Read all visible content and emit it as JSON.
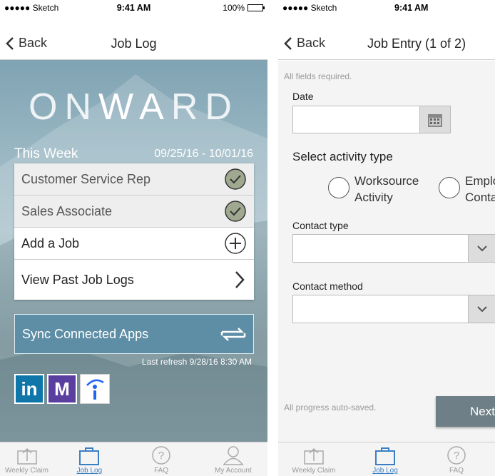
{
  "left": {
    "status": {
      "carrier": "●●●●● Sketch",
      "time": "9:41 AM",
      "battery": "100%"
    },
    "nav": {
      "back": "Back",
      "title": "Job Log"
    },
    "logo": {
      "part1": "ON",
      "part2": "WA",
      "part3": "RD"
    },
    "week": {
      "label": "This Week",
      "range": "09/25/16 - 10/01/16"
    },
    "jobs": [
      {
        "label": "Customer Service Rep",
        "icon": "check-circle-icon"
      },
      {
        "label": "Sales Associate",
        "icon": "check-circle-icon"
      },
      {
        "label": "Add a Job",
        "icon": "plus-circle-icon"
      },
      {
        "label": "View Past Job Logs",
        "icon": "chevron-right-icon"
      }
    ],
    "sync": {
      "label": "Sync Connected Apps",
      "refresh": "Last refresh 9/28/16 8:30 AM"
    },
    "apps": [
      {
        "name": "linkedin",
        "glyph": "in"
      },
      {
        "name": "monster",
        "glyph": "M"
      },
      {
        "name": "indeed",
        "glyph": "i"
      }
    ]
  },
  "right": {
    "status": {
      "carrier": "●●●●● Sketch",
      "time": "9:41 AM"
    },
    "nav": {
      "back": "Back",
      "title": "Job Entry (1 of 2)"
    },
    "hint": "All fields required.",
    "date_label": "Date",
    "date_value": "",
    "activity_label": "Select activity type",
    "activity_options": [
      "Worksource\nActivity",
      "Emplo\nConta"
    ],
    "contact_type_label": "Contact type",
    "contact_method_label": "Contact method",
    "autosave": "All progress auto-saved.",
    "next": "Next"
  },
  "tabs": [
    "Weekly Claim",
    "Job Log",
    "FAQ",
    "My Account"
  ],
  "colors": {
    "accent": "#3a7fc4",
    "sync": "#5e8ea6",
    "check": "#a0a890"
  }
}
